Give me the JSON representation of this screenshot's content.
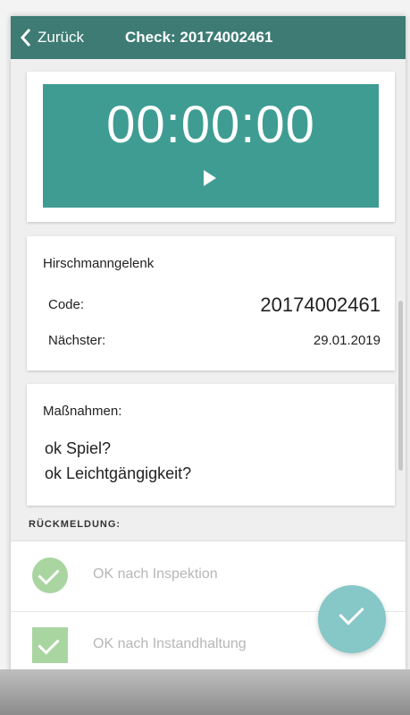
{
  "header": {
    "back_label": "Zurück",
    "title": "Check: 20174002461"
  },
  "timer": {
    "value": "00:00:00"
  },
  "info": {
    "title": "Hirschmanngelenk",
    "code_label": "Code:",
    "code_value": "20174002461",
    "next_label": "Nächster:",
    "next_value": "29.01.2019"
  },
  "actions": {
    "title": "Maßnahmen:",
    "items": [
      "ok Spiel?",
      "ok Leichtgängigkeit?"
    ]
  },
  "feedback": {
    "section_label": "RÜCKMELDUNG:",
    "options": [
      {
        "label": "OK nach Inspektion",
        "icon": "check-circle-icon"
      },
      {
        "label": "OK nach Instandhaltung",
        "icon": "check-square-icon"
      }
    ]
  },
  "colors": {
    "header": "#3d7b74",
    "timer_background": "#3f9c93",
    "option_icon": "#a9d5a1",
    "fab": "#86c7c8"
  }
}
